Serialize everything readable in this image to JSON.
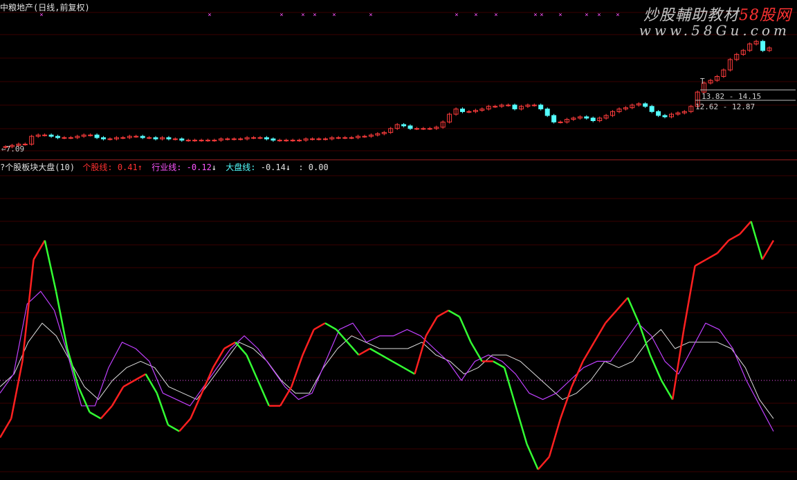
{
  "window": {
    "title": "中粮地产(日线,前复权)"
  },
  "watermark": {
    "line1_prefix": "炒股輔助教材",
    "line1_brand": "58股网",
    "line2": "www.58Gu.com"
  },
  "main_panel": {
    "low_label": "7.09",
    "peak_marker": "T",
    "price_box_upper": "13.82 - 14.15",
    "price_box_lower": "12.62 - 12.87"
  },
  "indicator": {
    "title_prefix": "?个股板块大盘(10)",
    "stock_label": "个股线:",
    "stock_value": "0.41",
    "stock_arrow": "↑",
    "sector_label": "行业线:",
    "sector_value": "-0.12",
    "sector_arrow": "↓",
    "market_label": "大盘线:",
    "market_value": "-0.14",
    "market_arrow": "↓",
    "extra_value": ": 0.00"
  },
  "colors": {
    "bg": "#000000",
    "up": "#ff3c3c",
    "down": "#54ffff",
    "stock_rising": "#ff2020",
    "stock_falling": "#33ff33",
    "sector": "#c040ff",
    "market": "#e0e0e0",
    "grid": "#3a0000",
    "separator": "#a02020",
    "zero_line": "#ff55ff",
    "sector_label_color": "#ff55ff",
    "market_label_color": "#54ffff",
    "text": "#e0e0e0"
  },
  "chart_data": [
    {
      "type": "candlestick",
      "series_name": "中粮地产 日线",
      "values_close_approx": [
        7.1,
        7.2,
        7.3,
        7.3,
        7.9,
        8.0,
        8.0,
        7.9,
        7.8,
        7.8,
        7.8,
        7.9,
        8.0,
        8.0,
        7.8,
        7.7,
        7.7,
        7.8,
        7.8,
        7.9,
        7.9,
        7.8,
        7.8,
        7.7,
        7.8,
        7.7,
        7.7,
        7.6,
        7.6,
        7.6,
        7.6,
        7.6,
        7.6,
        7.7,
        7.7,
        7.7,
        7.7,
        7.8,
        7.8,
        7.8,
        7.7,
        7.6,
        7.6,
        7.6,
        7.6,
        7.6,
        7.7,
        7.7,
        7.7,
        7.7,
        7.8,
        7.8,
        7.8,
        7.8,
        7.9,
        7.9,
        8.0,
        8.1,
        8.2,
        8.5,
        8.8,
        8.7,
        8.5,
        8.5,
        8.5,
        8.5,
        8.6,
        9.0,
        9.6,
        10.0,
        9.8,
        9.8,
        9.9,
        10.0,
        10.2,
        10.2,
        10.3,
        10.3,
        10.0,
        10.2,
        10.3,
        10.3,
        10.0,
        9.5,
        9.0,
        9.0,
        9.2,
        9.3,
        9.4,
        9.3,
        9.1,
        9.3,
        9.5,
        9.8,
        10.0,
        10.1,
        10.3,
        10.4,
        10.2,
        9.8,
        9.5,
        9.4,
        9.6,
        9.7,
        9.8,
        10.2,
        11.3,
        12.0,
        12.2,
        12.5,
        13.0,
        13.8,
        14.2,
        14.5,
        15.0,
        15.2,
        14.5,
        14.7
      ],
      "annotations": [
        "7.09",
        "T",
        "13.82 - 14.15",
        "12.62 - 12.87"
      ]
    },
    {
      "type": "line",
      "title": "?个股板块大盘(10)",
      "series": [
        {
          "name": "个股线",
          "values": [
            -0.9,
            -0.6,
            0.3,
            1.9,
            2.2,
            1.4,
            0.5,
            -0.1,
            -0.5,
            -0.6,
            -0.4,
            -0.1,
            0.0,
            0.1,
            -0.2,
            -0.7,
            -0.8,
            -0.6,
            -0.2,
            0.2,
            0.5,
            0.6,
            0.4,
            0.0,
            -0.4,
            -0.4,
            -0.1,
            0.4,
            0.8,
            0.9,
            0.8,
            0.6,
            0.4,
            0.5,
            0.4,
            0.3,
            0.2,
            0.1,
            0.7,
            1.0,
            1.1,
            1.0,
            0.6,
            0.3,
            0.3,
            0.2,
            -0.4,
            -1.0,
            -1.4,
            -1.2,
            -0.6,
            -0.1,
            0.3,
            0.6,
            0.9,
            1.1,
            1.3,
            0.9,
            0.4,
            0.0,
            -0.3,
            0.8,
            1.8,
            1.9,
            2.0,
            2.2,
            2.3,
            2.5,
            1.9,
            2.2
          ]
        },
        {
          "name": "行业线",
          "values": [
            -0.2,
            0.1,
            1.2,
            1.4,
            1.1,
            0.4,
            -0.4,
            -0.4,
            0.2,
            0.6,
            0.5,
            0.3,
            -0.2,
            -0.3,
            -0.4,
            -0.1,
            0.2,
            0.5,
            0.7,
            0.5,
            0.2,
            -0.1,
            -0.3,
            -0.2,
            0.3,
            0.8,
            0.9,
            0.6,
            0.7,
            0.7,
            0.8,
            0.7,
            0.5,
            0.3,
            0.0,
            0.3,
            0.4,
            0.3,
            0.1,
            -0.2,
            -0.3,
            -0.2,
            0.0,
            0.2,
            0.3,
            0.3,
            0.6,
            0.9,
            0.7,
            0.3,
            0.1,
            0.5,
            0.9,
            0.8,
            0.5,
            0.0,
            -0.4,
            -0.8
          ]
        },
        {
          "name": "大盘线",
          "values": [
            -0.1,
            0.1,
            0.6,
            0.9,
            0.7,
            0.3,
            -0.1,
            -0.3,
            0.0,
            0.2,
            0.3,
            0.2,
            -0.1,
            -0.2,
            -0.3,
            0.0,
            0.3,
            0.6,
            0.5,
            0.3,
            0.0,
            -0.2,
            -0.2,
            0.2,
            0.5,
            0.7,
            0.6,
            0.5,
            0.5,
            0.5,
            0.6,
            0.4,
            0.3,
            0.1,
            0.2,
            0.4,
            0.4,
            0.3,
            0.1,
            -0.1,
            -0.3,
            -0.2,
            0.0,
            0.3,
            0.2,
            0.3,
            0.6,
            0.8,
            0.5,
            0.6,
            0.6,
            0.6,
            0.5,
            0.2,
            -0.3,
            -0.6
          ]
        }
      ],
      "current": {
        "个股线": 0.41,
        "行业线": -0.12,
        "大盘线": -0.14
      },
      "zero_line": 0.0
    }
  ]
}
